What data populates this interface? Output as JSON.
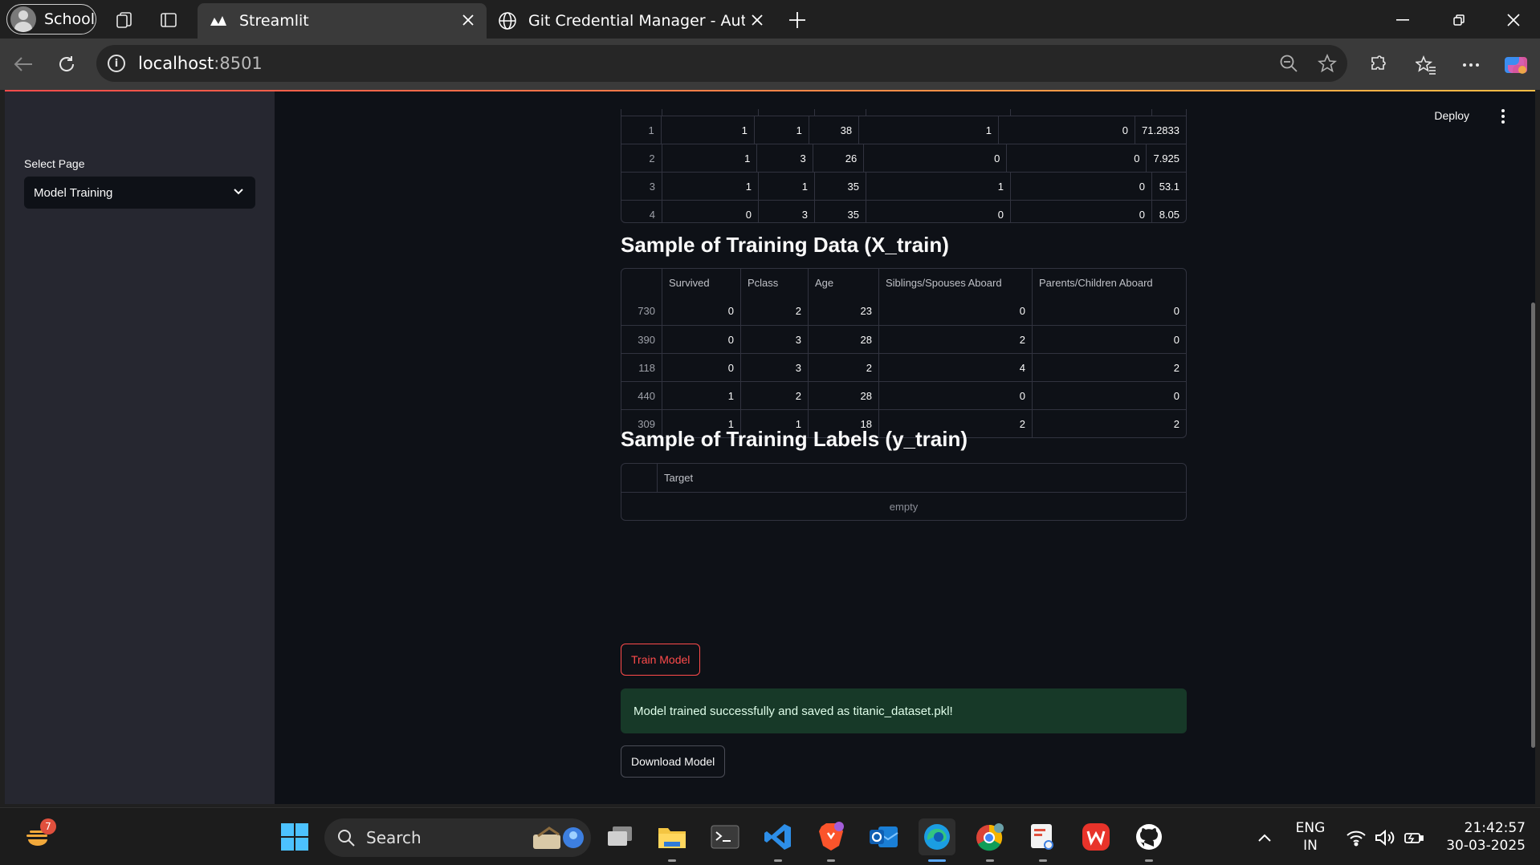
{
  "browser": {
    "profile_name": "School",
    "tabs": [
      {
        "label": "Streamlit",
        "active": true
      },
      {
        "label": "Git Credential Manager - Authent",
        "active": false
      }
    ],
    "url_host": "localhost",
    "url_port": ":8501"
  },
  "app": {
    "deploy_label": "Deploy",
    "sidebar": {
      "select_label": "Select Page",
      "selected_page": "Model Training"
    },
    "top_table": {
      "rows": [
        {
          "index": "1",
          "values": [
            "1",
            "1",
            "38",
            "1",
            "0",
            "71.2833"
          ]
        },
        {
          "index": "2",
          "values": [
            "1",
            "3",
            "26",
            "0",
            "0",
            "7.925"
          ]
        },
        {
          "index": "3",
          "values": [
            "1",
            "1",
            "35",
            "1",
            "0",
            "53.1"
          ]
        },
        {
          "index": "4",
          "values": [
            "0",
            "3",
            "35",
            "0",
            "0",
            "8.05"
          ]
        }
      ]
    },
    "x_train": {
      "title": "Sample of Training Data (X_train)",
      "columns": [
        "Survived",
        "Pclass",
        "Age",
        "Siblings/Spouses Aboard",
        "Parents/Children Aboard"
      ],
      "rows": [
        {
          "index": "730",
          "values": [
            "0",
            "2",
            "23",
            "0",
            "0"
          ]
        },
        {
          "index": "390",
          "values": [
            "0",
            "3",
            "28",
            "2",
            "0"
          ]
        },
        {
          "index": "118",
          "values": [
            "0",
            "3",
            "2",
            "4",
            "2"
          ]
        },
        {
          "index": "440",
          "values": [
            "1",
            "2",
            "28",
            "0",
            "0"
          ]
        },
        {
          "index": "309",
          "values": [
            "1",
            "1",
            "18",
            "2",
            "2"
          ]
        }
      ]
    },
    "y_train": {
      "title": "Sample of Training Labels (y_train)",
      "column": "Target",
      "empty_text": "empty"
    },
    "train_button": "Train Model",
    "success_message": "Model trained successfully and saved as titanic_dataset.pkl!",
    "download_button": "Download Model"
  },
  "taskbar": {
    "search_placeholder": "Search",
    "widget_badge": "7",
    "language_line1": "ENG",
    "language_line2": "IN",
    "time": "21:42:57",
    "date": "30-03-2025",
    "accent_color": "#5aa9ff"
  }
}
